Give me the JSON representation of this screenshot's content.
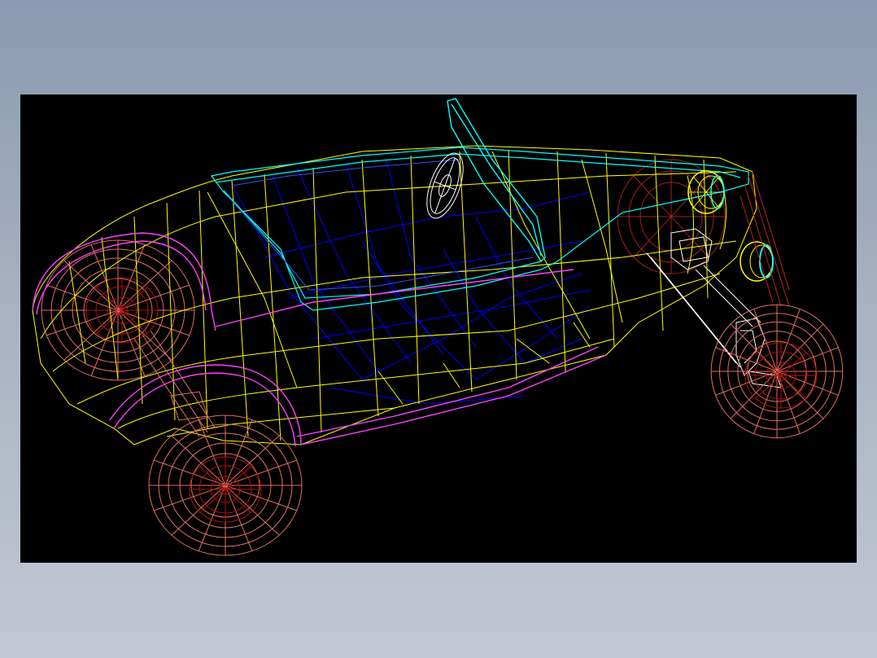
{
  "view": {
    "background": "#000000",
    "frame_gradient": [
      "#8a9ab0",
      "#c3c8d2"
    ]
  },
  "model": {
    "subject": "roadster-car-wireframe",
    "render_style": "wireframe",
    "layer_colors": {
      "body": "#ffff00",
      "cockpit_rim": "#00ffff",
      "floor": "#0000ff",
      "fender_trim": "#ff40ff",
      "wheels": "#e07060",
      "wheel_hubs": "#b01010",
      "details": "#ffffff",
      "headlights": "#ffff00"
    }
  }
}
